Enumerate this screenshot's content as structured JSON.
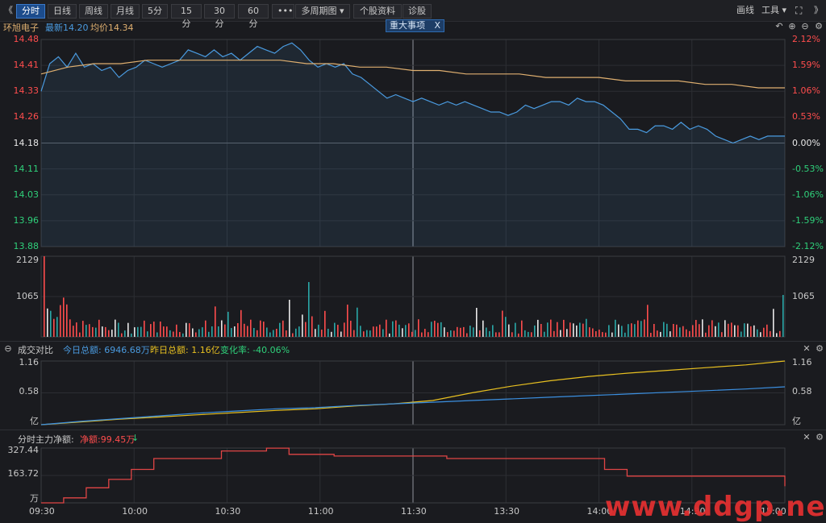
{
  "toolbar": {
    "left_arrow": "《",
    "buttons": [
      "分时",
      "日线",
      "周线",
      "月线",
      "5分",
      "15分",
      "30分",
      "60分",
      "•••",
      "多周期图 ▾",
      "个股资料",
      "诊股"
    ],
    "right": [
      "画线",
      "工具 ▾"
    ],
    "right_arrow": "》"
  },
  "header": {
    "stock_name": "环旭电子",
    "latest_label": "最新14.20",
    "avg_label": "均价14.34",
    "event_tag": "重大事项",
    "event_close": "X"
  },
  "price_panel": {
    "left_ticks": [
      "14.48",
      "14.41",
      "14.33",
      "14.26",
      "14.18",
      "14.11",
      "14.03",
      "13.96",
      "13.88"
    ],
    "right_ticks": [
      "2.12%",
      "1.59%",
      "1.06%",
      "0.53%",
      "0.00%",
      "-0.53%",
      "-1.06%",
      "-1.59%",
      "-2.12%"
    ]
  },
  "volume_panel": {
    "left_ticks": [
      "2129",
      "1065"
    ],
    "right_ticks": [
      "2129",
      "1065"
    ]
  },
  "compare_panel": {
    "title": "成交对比",
    "today_label": "今日总额: 6946.68万",
    "yesterday_label": "昨日总额: 1.16亿",
    "change_label": "变化率: -40.06%",
    "left_ticks": [
      "1.16",
      "0.58",
      "亿"
    ],
    "right_ticks": [
      "1.16",
      "0.58",
      "亿"
    ]
  },
  "flow_panel": {
    "title": "分时主力净额:",
    "net_label": "净额:99.45万",
    "net_arrow": "↓",
    "left_ticks": [
      "327.44",
      "163.72",
      "万"
    ]
  },
  "time_axis": [
    "09:30",
    "10:00",
    "10:30",
    "11:00",
    "11:30",
    "13:30",
    "14:00",
    "14:30",
    "15:00"
  ],
  "watermark": "www.ddgp.net",
  "colors": {
    "background": "#1a1b1f",
    "price_line": "#4a9be0",
    "avg_line": "#e0b070",
    "up_red": "#ff4d4d",
    "down_green": "#2fd07a",
    "today_line": "#3b8fe0",
    "yesterday_line": "#e8c020",
    "flow_line": "#e04545"
  },
  "chart_data": [
    {
      "type": "line",
      "name_series_note": "",
      "series": [
        {
          "name": "最新",
          "values": [
            14.33,
            14.41,
            14.43,
            14.4,
            14.44,
            14.4,
            14.41,
            14.39,
            14.4,
            14.37,
            14.39,
            14.4,
            14.42,
            14.41,
            14.4,
            14.41,
            14.42,
            14.45,
            14.44,
            14.43,
            14.45,
            14.43,
            14.44,
            14.42,
            14.44,
            14.46,
            14.45,
            14.44,
            14.46,
            14.47,
            14.45,
            14.42,
            14.4,
            14.41,
            14.4,
            14.41,
            14.38,
            14.37,
            14.35,
            14.33,
            14.31,
            14.32,
            14.31,
            14.3,
            14.31,
            14.3,
            14.29,
            14.3,
            14.29,
            14.3,
            14.29,
            14.28,
            14.27,
            14.27,
            14.26,
            14.27,
            14.29,
            14.28,
            14.29,
            14.3,
            14.3,
            14.29,
            14.31,
            14.3,
            14.3,
            14.29,
            14.27,
            14.25,
            14.22,
            14.22,
            14.21,
            14.23,
            14.23,
            14.22,
            14.24,
            14.22,
            14.23,
            14.22,
            14.2,
            14.19,
            14.18,
            14.19,
            14.2,
            14.19,
            14.2,
            14.2,
            14.2
          ]
        },
        {
          "name": "均价",
          "values": [
            14.38,
            14.4,
            14.41,
            14.41,
            14.42,
            14.42,
            14.42,
            14.42,
            14.42,
            14.42,
            14.41,
            14.41,
            14.4,
            14.4,
            14.39,
            14.39,
            14.38,
            14.38,
            14.38,
            14.37,
            14.37,
            14.37,
            14.36,
            14.36,
            14.36,
            14.35,
            14.35,
            14.34,
            14.34
          ]
        }
      ],
      "ylim": [
        13.88,
        14.48
      ]
    },
    {
      "type": "bar",
      "name": "volume",
      "ylim": [
        0,
        2129
      ]
    },
    {
      "type": "line",
      "series": [
        {
          "name": "今日总额",
          "values": [
            0.0,
            0.06,
            0.11,
            0.16,
            0.21,
            0.25,
            0.29,
            0.31,
            0.35,
            0.38,
            0.41,
            0.44,
            0.47,
            0.5,
            0.53,
            0.56,
            0.59,
            0.62,
            0.65,
            0.69
          ]
        },
        {
          "name": "昨日总额",
          "values": [
            0.0,
            0.05,
            0.1,
            0.14,
            0.18,
            0.22,
            0.26,
            0.29,
            0.34,
            0.38,
            0.44,
            0.58,
            0.7,
            0.8,
            0.88,
            0.94,
            0.99,
            1.04,
            1.09,
            1.16
          ]
        }
      ],
      "ylim": [
        0,
        1.16
      ]
    },
    {
      "type": "line",
      "series": [
        {
          "name": "净额",
          "values": [
            0,
            30,
            90,
            140,
            200,
            265,
            265,
            265,
            310,
            310,
            327,
            290,
            290,
            280,
            280,
            280,
            280,
            280,
            265,
            265,
            265,
            265,
            265,
            265,
            265,
            200,
            160,
            160,
            160,
            160,
            160,
            160,
            160,
            99
          ]
        }
      ],
      "ylim": [
        0,
        327.44
      ]
    }
  ]
}
